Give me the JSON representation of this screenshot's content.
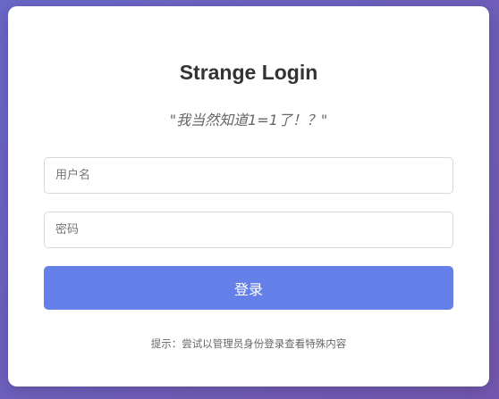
{
  "login": {
    "title": "Strange Login",
    "quote": "\"我当然知道1=1了！？\"",
    "username_placeholder": "用户名",
    "password_placeholder": "密码",
    "submit_label": "登录",
    "hint": "提示：尝试以管理员身份登录查看特殊内容"
  },
  "colors": {
    "background_gradient": [
      "#6a68c9",
      "#7357b0"
    ],
    "button": "#6680e9",
    "card": "#ffffff"
  }
}
